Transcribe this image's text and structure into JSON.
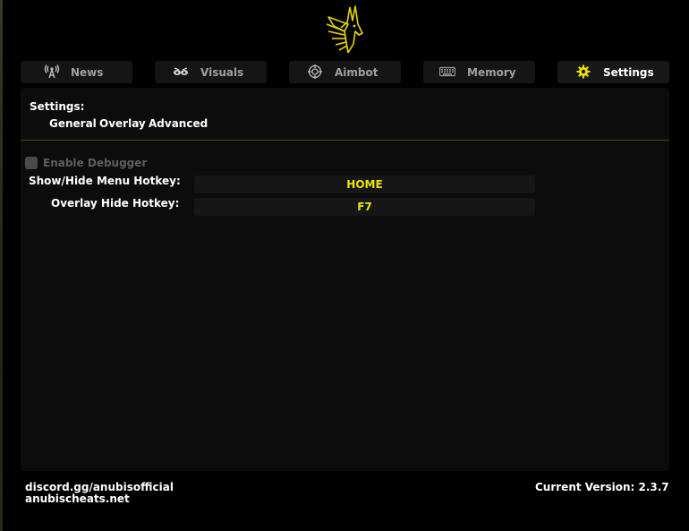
{
  "colors": {
    "accent": "#f0e400",
    "panel": "#0c0c0c",
    "tab": "#151515",
    "divider": "#4d4a16"
  },
  "logo": {
    "icon": "anubis-logo"
  },
  "tabs": [
    {
      "label": "News",
      "icon": "antenna-icon"
    },
    {
      "label": "Visuals",
      "icon": "eyes-icon"
    },
    {
      "label": "Aimbot",
      "icon": "crosshair-icon"
    },
    {
      "label": "Memory",
      "icon": "keyboard-icon"
    },
    {
      "label": "Settings",
      "icon": "gear-icon",
      "active": true
    }
  ],
  "settings": {
    "title": "Settings:",
    "subtabs": [
      "General",
      "Overlay",
      "Advanced"
    ],
    "debugger_label": "Enable Debugger",
    "debugger_checked": false,
    "menu_hotkey_label": "Show/Hide Menu Hotkey:",
    "menu_hotkey_value": "HOME",
    "overlay_hotkey_label": "Overlay Hide Hotkey:",
    "overlay_hotkey_value": "F7"
  },
  "footer": {
    "discord": "discord.gg/anubisofficial",
    "website": "anubischeats.net",
    "version": "Current Version: 2.3.7"
  }
}
